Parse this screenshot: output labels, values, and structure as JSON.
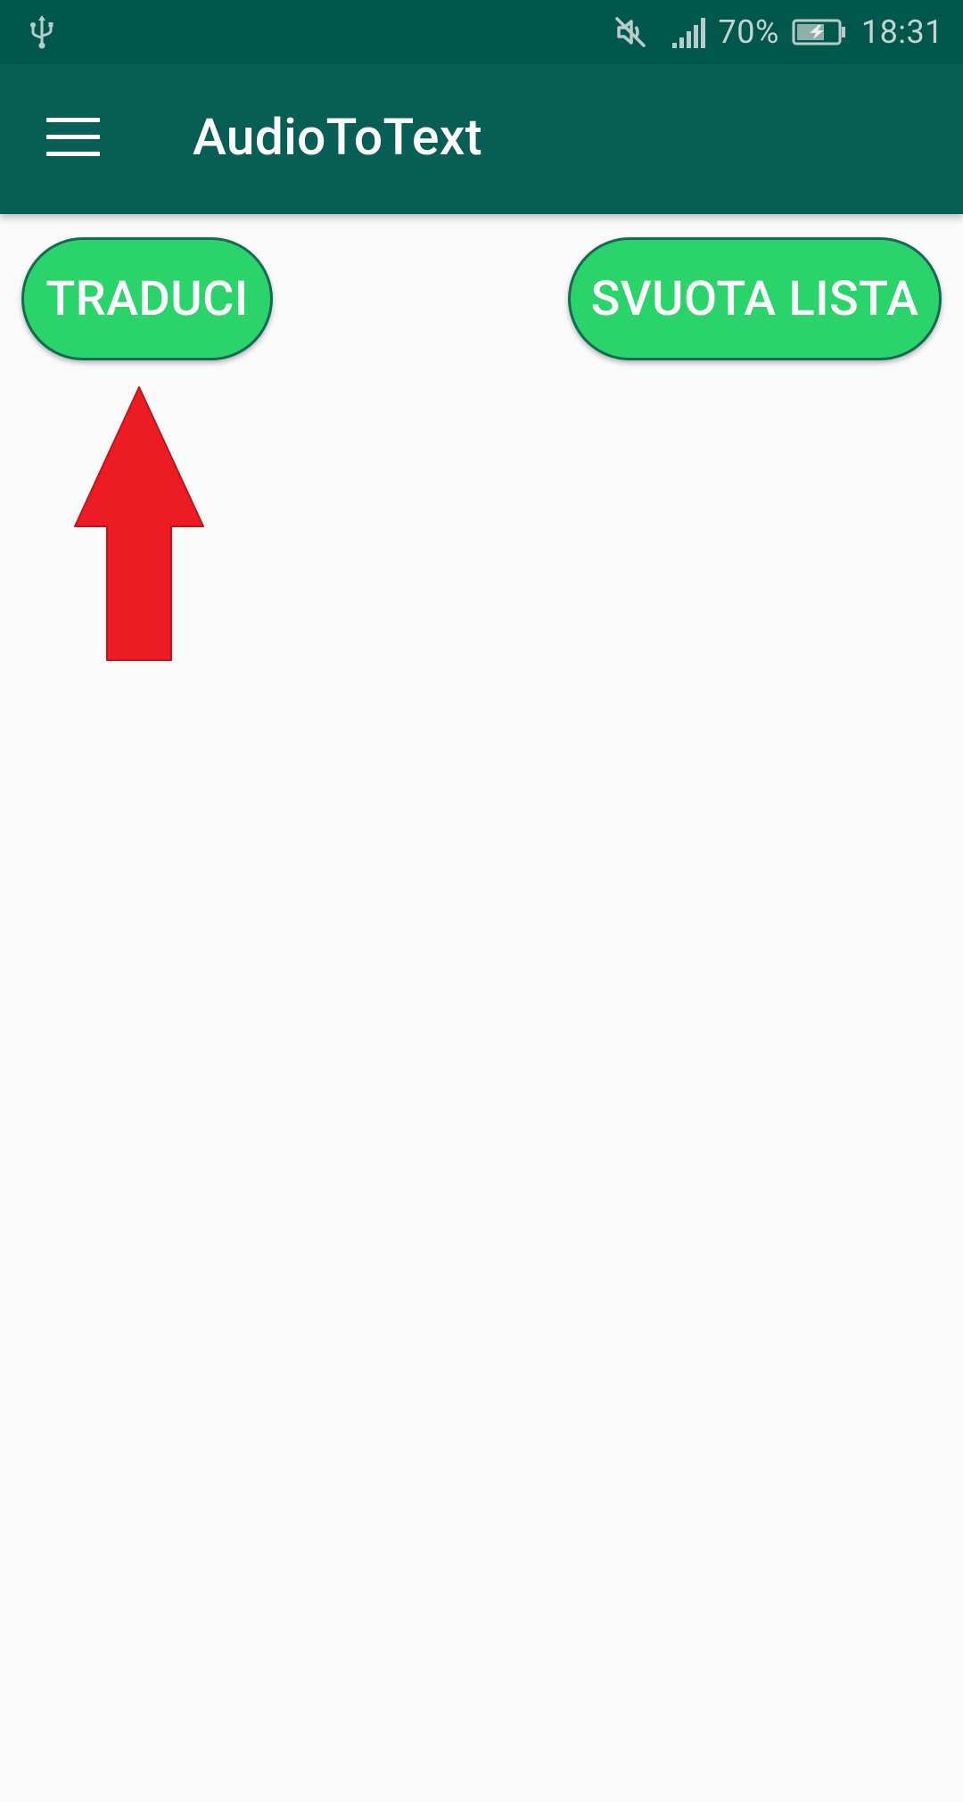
{
  "status_bar": {
    "battery_percent": "70%",
    "time": "18:31",
    "icons": [
      "usb-icon",
      "mute-icon",
      "signal-icon",
      "battery-charging-icon"
    ]
  },
  "app_bar": {
    "title": "AudioToText",
    "menu_icon": "hamburger-menu-icon"
  },
  "buttons": {
    "translate_label": "TRADUCI",
    "clear_list_label": "SVUOTA LISTA"
  },
  "annotation": {
    "arrow_icon": "red-up-arrow",
    "arrow_color": "#ed1c24"
  },
  "colors": {
    "status_bar": "#00574b",
    "app_bar": "#075e54",
    "button_fill": "#2bd46a",
    "button_border": "#136b55",
    "background": "#fafafa"
  }
}
